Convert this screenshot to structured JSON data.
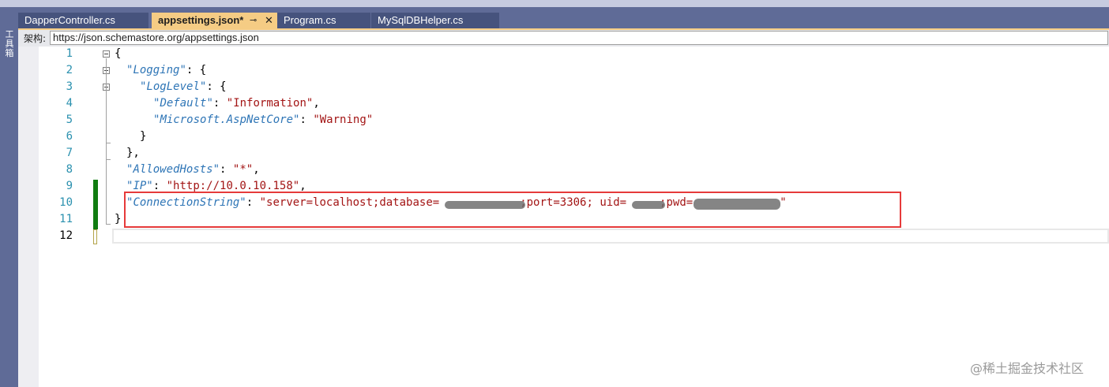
{
  "sidebar": {
    "label": "工具箱"
  },
  "tabs": [
    {
      "label": "DapperController.cs",
      "active": false
    },
    {
      "label": "appsettings.json*",
      "active": true,
      "pin_icon": "pin-icon",
      "close_icon": "close-icon"
    },
    {
      "label": "Program.cs",
      "active": false
    },
    {
      "label": "MySqlDBHelper.cs",
      "active": false
    }
  ],
  "schema": {
    "label": "架构:",
    "value": "https://json.schemastore.org/appsettings.json"
  },
  "lines": [
    {
      "number": "1",
      "code": "{"
    },
    {
      "number": "2",
      "key": "Logging",
      "suffix": ": {"
    },
    {
      "number": "3",
      "key": "LogLevel",
      "suffix": ": {"
    },
    {
      "number": "4",
      "key": "Default",
      "value": "Information",
      "suffix": ","
    },
    {
      "number": "5",
      "key": "Microsoft.AspNetCore",
      "value": "Warning",
      "suffix": ""
    },
    {
      "number": "6",
      "code": "}"
    },
    {
      "number": "7",
      "code": "},"
    },
    {
      "number": "8",
      "key": "AllowedHosts",
      "value": "*",
      "suffix": ","
    },
    {
      "number": "9",
      "key": "IP",
      "value": "http://10.0.10.158",
      "suffix": ","
    },
    {
      "number": "10",
      "key": "ConnectionString",
      "value": "server=localhost;database=",
      "value_tail": ";port=3306; uid=",
      "value_tail2": ";pwd="
    },
    {
      "number": "11",
      "code": "}"
    },
    {
      "number": "12",
      "code": ""
    }
  ],
  "watermark": "@稀土掘金技术社区",
  "colors": {
    "tab_bar": "#5f6b97",
    "active_tab": "#f5cc84",
    "json_key": "#2e75b6",
    "json_string": "#a31515",
    "line_number": "#2b91af",
    "change_marker": "#107c10",
    "highlight_box": "#e63a3a"
  }
}
